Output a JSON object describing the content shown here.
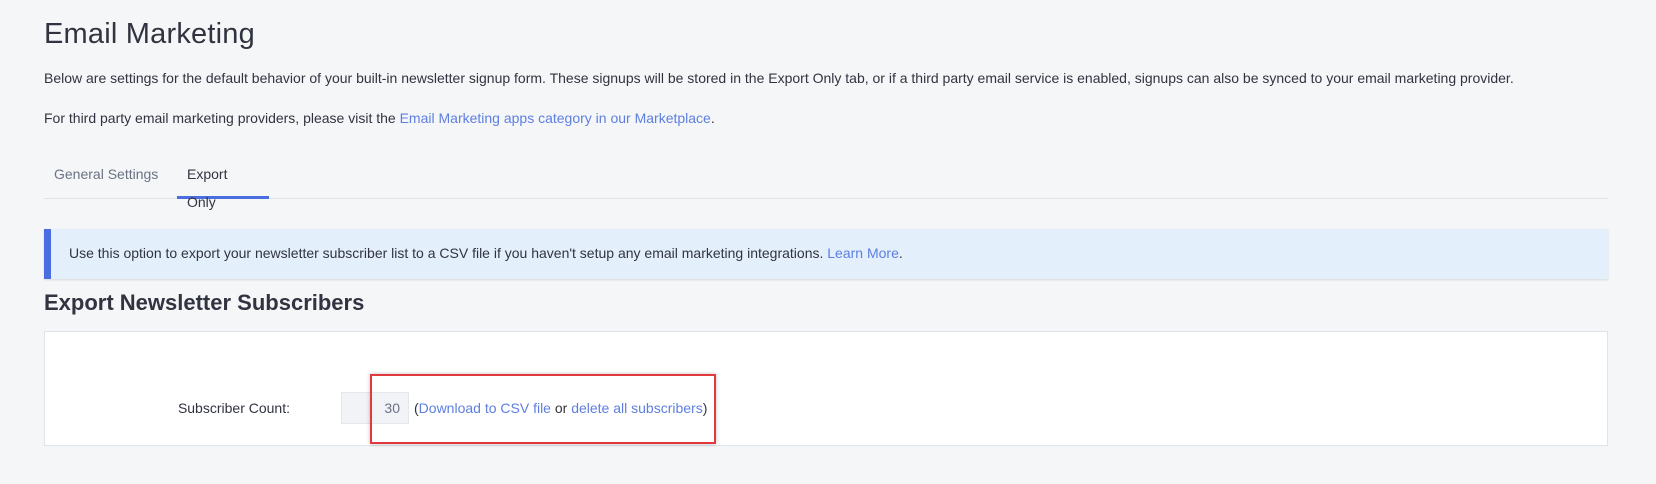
{
  "page": {
    "title": "Email Marketing",
    "intro": "Below are settings for the default behavior of your built-in newsletter signup form. These signups will be stored in the Export Only tab, or if a third party email service is enabled, signups can also be synced to your email marketing provider.",
    "providers_prefix": "For third party email marketing providers, please visit the ",
    "providers_link": "Email Marketing apps category in our Marketplace",
    "providers_suffix": "."
  },
  "tabs": [
    {
      "label": "General Settings",
      "active": false
    },
    {
      "label": "Export Only",
      "active": true
    }
  ],
  "alert": {
    "text": "Use this option to export your newsletter subscriber list to a CSV file if you haven't setup any email marketing integrations. ",
    "link": "Learn More",
    "suffix": "."
  },
  "export": {
    "heading": "Export Newsletter Subscribers",
    "count_label": "Subscriber Count:",
    "count_value": "30",
    "open_paren": "(",
    "download_link": "Download to CSV file",
    "or_text": " or ",
    "delete_link": "delete all subscribers",
    "close_paren": ")"
  },
  "colors": {
    "accent": "#4a6ee0",
    "link": "#5e7fe0",
    "alert_bg": "#e3effb",
    "highlight": "#e0393e"
  }
}
